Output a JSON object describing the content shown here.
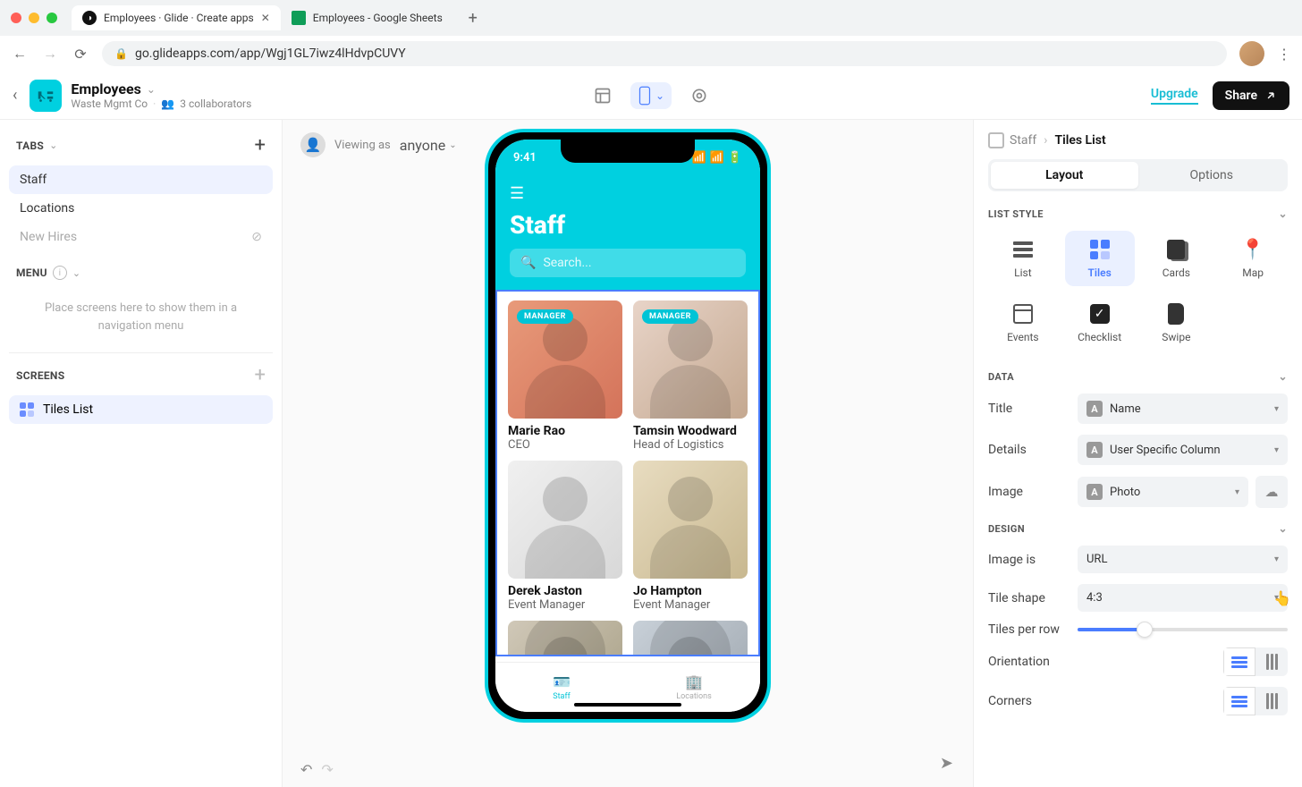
{
  "browser": {
    "tabs": [
      {
        "title": "Employees · Glide · Create apps"
      },
      {
        "title": "Employees - Google Sheets"
      }
    ],
    "url": "go.glideapps.com/app/Wgj1GL7iwz4lHdvpCUVY"
  },
  "header": {
    "title": "Employees",
    "org": "Waste Mgmt Co",
    "collaborators": "3 collaborators",
    "upgrade": "Upgrade",
    "share": "Share"
  },
  "left": {
    "tabs_label": "TABS",
    "menu_label": "MENU",
    "screens_label": "SCREENS",
    "tabs": [
      "Staff",
      "Locations",
      "New Hires"
    ],
    "menu_placeholder": "Place screens here to show them in a navigation menu",
    "screens": [
      "Tiles List"
    ]
  },
  "viewing": {
    "label": "Viewing as",
    "value": "anyone"
  },
  "phone": {
    "time": "9:41",
    "title": "Staff",
    "search_placeholder": "Search...",
    "staff": [
      {
        "name": "Marie Rao",
        "role": "CEO",
        "badge": "MANAGER"
      },
      {
        "name": "Tamsin Woodward",
        "role": "Head of Logistics",
        "badge": "MANAGER"
      },
      {
        "name": "Derek Jaston",
        "role": "Event Manager",
        "badge": null
      },
      {
        "name": "Jo Hampton",
        "role": "Event Manager",
        "badge": null
      }
    ],
    "bottom_tabs": [
      "Staff",
      "Locations"
    ]
  },
  "right": {
    "breadcrumb_ctx": "Staff",
    "breadcrumb_current": "Tiles List",
    "seg": [
      "Layout",
      "Options"
    ],
    "list_style_label": "LIST STYLE",
    "styles": [
      "List",
      "Tiles",
      "Cards",
      "Map",
      "Events",
      "Checklist",
      "Swipe"
    ],
    "data_label": "DATA",
    "design_label": "DESIGN",
    "props": {
      "title_label": "Title",
      "title_value": "Name",
      "details_label": "Details",
      "details_value": "User Specific Column",
      "image_label": "Image",
      "image_value": "Photo",
      "image_is_label": "Image is",
      "image_is_value": "URL",
      "tile_shape_label": "Tile shape",
      "tile_shape_value": "4:3",
      "tiles_per_row_label": "Tiles per row",
      "orientation_label": "Orientation",
      "corners_label": "Corners"
    }
  }
}
